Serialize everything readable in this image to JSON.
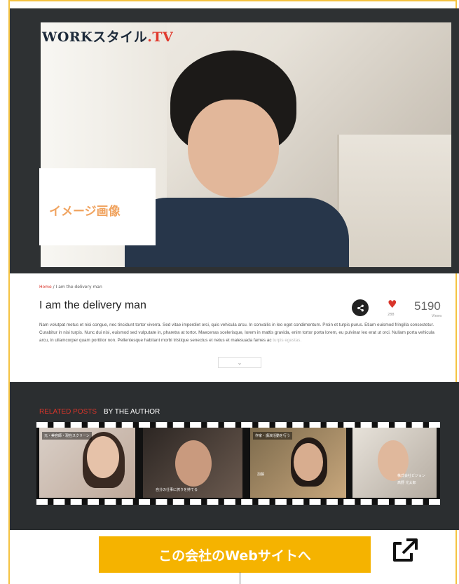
{
  "hero": {
    "logo_main": "WORKスタイル",
    "logo_tv": ".TV",
    "image_label": "イメージ画像"
  },
  "article": {
    "breadcrumb_home": "Home",
    "breadcrumb_sep": " / ",
    "breadcrumb_current": "I am the delivery man",
    "title": "I am the delivery man",
    "likes": "288",
    "views": "5190",
    "views_label": "Views",
    "body": "Nam volutpat metus et nisi congue, nec tincidunt tortor viverra. Sed vitae imperdiet orci, quis vehicula arcu. In convallis in leo eget condimentum. Proin et turpis purus. Etiam euismod fringilla consectetur. Curabitur in nisi turpis. Nunc dui nisi, euismod sed vulputate in, pharetra at tortor. Maecenas scelerisque, lorem in mattis gravida, enim tortor porta lorem, eu pulvinar leo erat ut orci. Nullam porta vehicula arcu, in ullamcorper quam porttitor non. Pellentesque habitant morbi tristique senectus et netus et malesuada fames ac",
    "body_fade": "turpis egestas.",
    "more_icon": "chevron-down-icon"
  },
  "related": {
    "tab_related": "RELATED POSTS",
    "tab_author": "BY THE AUTHOR",
    "thumbs": [
      {
        "caption": "元・美容師・現在スクリーン"
      },
      {
        "caption": "自分の仕事に誇りを持てる"
      },
      {
        "caption": "作家・講演活動を行う",
        "caption2": "加藤"
      },
      {
        "caption": "株式会社ビジョン",
        "caption2": "高野 光太郎"
      }
    ]
  },
  "cta": {
    "label": "この会社のWebサイトへ",
    "icon": "external-link-icon"
  },
  "colors": {
    "accent_yellow": "#f5b300",
    "brand_red": "#d9352a",
    "dark_bg": "#2b2e30"
  }
}
